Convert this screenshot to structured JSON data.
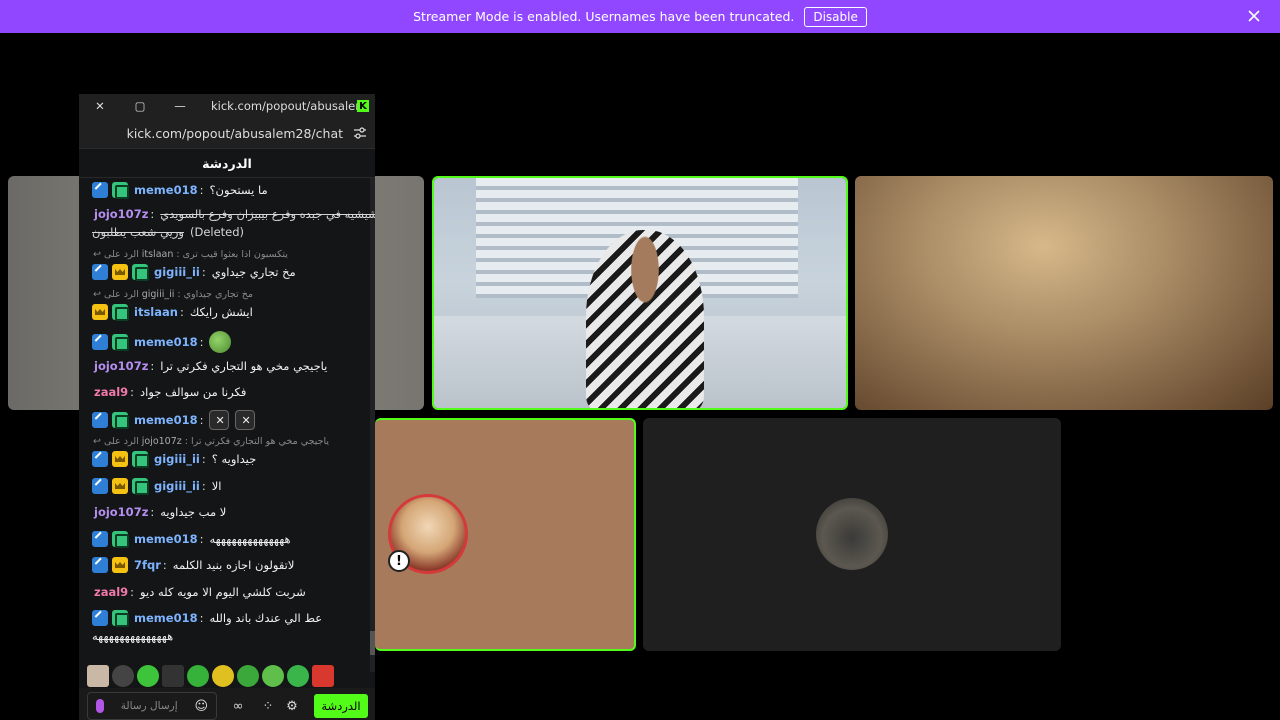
{
  "banner": {
    "message": "Streamer Mode is enabled. Usernames have been truncated.",
    "disable_label": "Disable",
    "bg_color": "#9147ff",
    "close_icon": "close-icon"
  },
  "popout": {
    "title": "kick.com/popout/abusalem28...",
    "url": "kick.com/popout/abusalem28/chat",
    "chat_header": "الدردشة"
  },
  "chat": {
    "messages": [
      {
        "user": "meme018",
        "text": "ما يستحون؟"
      },
      {
        "user": "jojo107z",
        "text_line1": "قيب وشيشيه في جبده وفرع بيبيزان وفرع بالسويدي",
        "text_line2": "وريي شعب يطلبون",
        "deleted_label": "(Deleted)"
      },
      {
        "reply_prefix": "الرد على",
        "reply_user": "itslaan",
        "reply_text": "يتكسبون اذا بعثوا قيب ترى"
      },
      {
        "user": "gigiii_ii",
        "text": "مخ تجاري جيداوي"
      },
      {
        "reply_prefix": "الرد على",
        "reply_user": "gigiii_ii",
        "reply_text": "مخ تجاري جيداوي"
      },
      {
        "user": "itslaan",
        "text": "ايشش رايكك"
      },
      {
        "user": "meme018",
        "text": ""
      },
      {
        "user": "jojo107z",
        "text": "ياجيجي مخي هو التجاري فكرتي ترا"
      },
      {
        "user": "zaal9",
        "text": "فكرنا من سوالف جواد"
      },
      {
        "user": "meme018",
        "text": ""
      },
      {
        "reply_prefix": "الرد على",
        "reply_user": "jojo107z",
        "reply_text": "ياجيجي مخي هو التجاري فكرتي ترا"
      },
      {
        "user": "gigiii_ii",
        "text": "جيداويه ؟"
      },
      {
        "user": "gigiii_ii",
        "text": "الا"
      },
      {
        "user": "jojo107z",
        "text": "لا مب جيداويه"
      },
      {
        "user": "meme018",
        "text": "ههههههههههههههه"
      },
      {
        "user": "7fqr",
        "text": "لاتقولون اجازه بنيد الكلمه"
      },
      {
        "user": "zaal9",
        "text": "شربت كلشي اليوم الا مويه كله ديو"
      },
      {
        "user": "meme018",
        "text_line1": "عط الي عندك باند والله",
        "text_line2": "ههههههههههههههه"
      }
    ]
  },
  "input": {
    "placeholder": "إرسال رسالة",
    "chat_button": "الدردشة"
  },
  "colors": {
    "accent": "#53fc18",
    "purple_banner": "#9147ff"
  }
}
